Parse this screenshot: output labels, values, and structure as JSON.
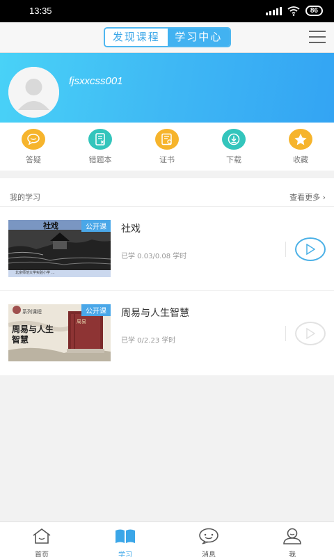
{
  "status_bar": {
    "time": "13:35",
    "battery": "86",
    "icons": [
      "signal-icon",
      "wifi-icon",
      "battery-icon"
    ]
  },
  "header": {
    "tabs": [
      {
        "label": "发现课程",
        "active": false
      },
      {
        "label": "学习中心",
        "active": true
      }
    ],
    "menu_icon": "menu-icon"
  },
  "profile": {
    "username": "fjsxxcss001",
    "avatar_icon": "avatar-icon"
  },
  "quick_actions": [
    {
      "label": "答疑",
      "icon": "chat-bubble-icon",
      "color": "#f6b42c"
    },
    {
      "label": "错题本",
      "icon": "notebook-icon",
      "color": "#33c5bc"
    },
    {
      "label": "证书",
      "icon": "certificate-icon",
      "color": "#f6b42c"
    },
    {
      "label": "下载",
      "icon": "download-icon",
      "color": "#33c5bc"
    },
    {
      "label": "收藏",
      "icon": "star-icon",
      "color": "#f6b42c"
    }
  ],
  "my_learning": {
    "title": "我的学习",
    "more_label": "查看更多",
    "courses": [
      {
        "title": "社戏",
        "tag": "公开课",
        "progress": "已学 0.03/0.08 学时",
        "thumb_title": "社戏",
        "thumb_caption": "北京师范大学实验小学 …"
      },
      {
        "title": "周易与人生智慧",
        "tag": "公开课",
        "progress": "已学 0/2.23 学时",
        "thumb_title": "周易与人生智慧",
        "thumb_series": "系列课程",
        "thumb_book": "周易"
      }
    ]
  },
  "bottom_nav": [
    {
      "label": "首页",
      "icon": "home-icon",
      "active": false
    },
    {
      "label": "学习",
      "icon": "book-icon",
      "active": true
    },
    {
      "label": "消息",
      "icon": "message-icon",
      "active": false
    },
    {
      "label": "我",
      "icon": "person-icon",
      "active": false
    }
  ],
  "colors": {
    "accent": "#3ba6e8",
    "banner_start": "#49d2f7",
    "banner_end": "#33a4f3",
    "yellow": "#f6b42c",
    "teal": "#33c5bc"
  }
}
